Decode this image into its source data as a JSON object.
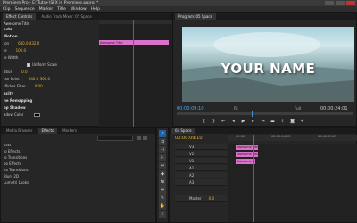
{
  "titlebar": {
    "title": "Premiere Pro - E:\\Tuts+\\SFX in Premiere.prproj *"
  },
  "menu": [
    "Clip",
    "Sequence",
    "Marker",
    "Title",
    "Window",
    "Help"
  ],
  "effect_controls": {
    "tabs": [
      "Effect Controls",
      "Audio Track Mixer: 05 Space"
    ],
    "clip_name": "Awesome Title",
    "section_label": "Awesome Title",
    "rows": [
      {
        "label": "ects",
        "value": "",
        "type": "sect"
      },
      {
        "label": "Motion",
        "value": "",
        "type": "sect"
      },
      {
        "label": "ion",
        "value": "640.0    432.0",
        "type": "val"
      },
      {
        "label": "le",
        "value": "100.0",
        "type": "val"
      },
      {
        "label": "le Width",
        "value": "",
        "type": "dim"
      },
      {
        "label": "",
        "value": "Uniform Scale",
        "type": "check"
      },
      {
        "label": "ation",
        "value": "0.0",
        "type": "val"
      },
      {
        "label": "hor Point",
        "value": "640.0    360.0",
        "type": "val"
      },
      {
        "label": "-flicker Filter",
        "value": "0.00",
        "type": "val"
      },
      {
        "label": "acity",
        "value": "",
        "type": "sect"
      },
      {
        "label": "ne Remapping",
        "value": "",
        "type": "sect"
      },
      {
        "label": "op Shadow",
        "value": "",
        "type": "sect"
      },
      {
        "label": "adow Color",
        "value": "",
        "type": "swatch"
      }
    ]
  },
  "program_monitor": {
    "tab": "Program: 05 Space",
    "title_text": "YOUR NAME",
    "timecode_current": "00:00:09:10",
    "fit": "Fit",
    "resolution": "Full",
    "timecode_duration": "00:00:24:01"
  },
  "effects_panel": {
    "tabs": [
      "Media Browser",
      "Effects",
      "Markers"
    ],
    "items": [
      "sets",
      "io Effects",
      "io Transitions",
      "eo Effects",
      "eo Transitions",
      "Blurs 2D",
      "Lumetri Looks"
    ]
  },
  "timeline": {
    "tab": "05 Space",
    "timecode": "00:00:09:10",
    "ruler": [
      "00:00",
      "00:00:04:23",
      "00:00:09:23"
    ],
    "tracks": [
      "V3",
      "V2",
      "V1",
      "A1",
      "A2",
      "A3",
      "Master"
    ],
    "master_value": "0.0",
    "clips": [
      {
        "label": "Awesome Title",
        "track": 0
      },
      {
        "label": "Awesome Title",
        "track": 1
      },
      {
        "label": "Awesome T...",
        "track": 2
      }
    ]
  }
}
